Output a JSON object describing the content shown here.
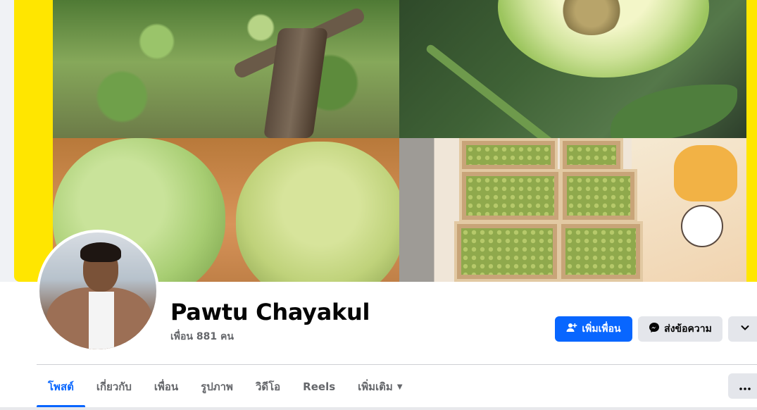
{
  "profile": {
    "name": "Pawtu Chayakul",
    "friends_text": "เพื่อน 881 คน"
  },
  "actions": {
    "add_friend_label": "เพิ่มเพื่อน",
    "message_label": "ส่งข้อความ"
  },
  "tabs": [
    {
      "label": "โพสต์",
      "active": true
    },
    {
      "label": "เกี่ยวกับ",
      "active": false
    },
    {
      "label": "เพื่อน",
      "active": false
    },
    {
      "label": "รูปภาพ",
      "active": false
    },
    {
      "label": "วิดีโอ",
      "active": false
    },
    {
      "label": "Reels",
      "active": false
    },
    {
      "label": "เพิ่มเติม",
      "active": false
    }
  ],
  "icons": {
    "add_friend": "person-plus-icon",
    "message": "messenger-icon",
    "more_actions": "chevron-down-icon",
    "tab_more": "caret-down-icon",
    "overflow": "more-horizontal-icon"
  },
  "colors": {
    "primary": "#0866ff",
    "cover_background": "#ffe600",
    "secondary_button": "#e4e6eb",
    "muted_text": "#65676b"
  }
}
